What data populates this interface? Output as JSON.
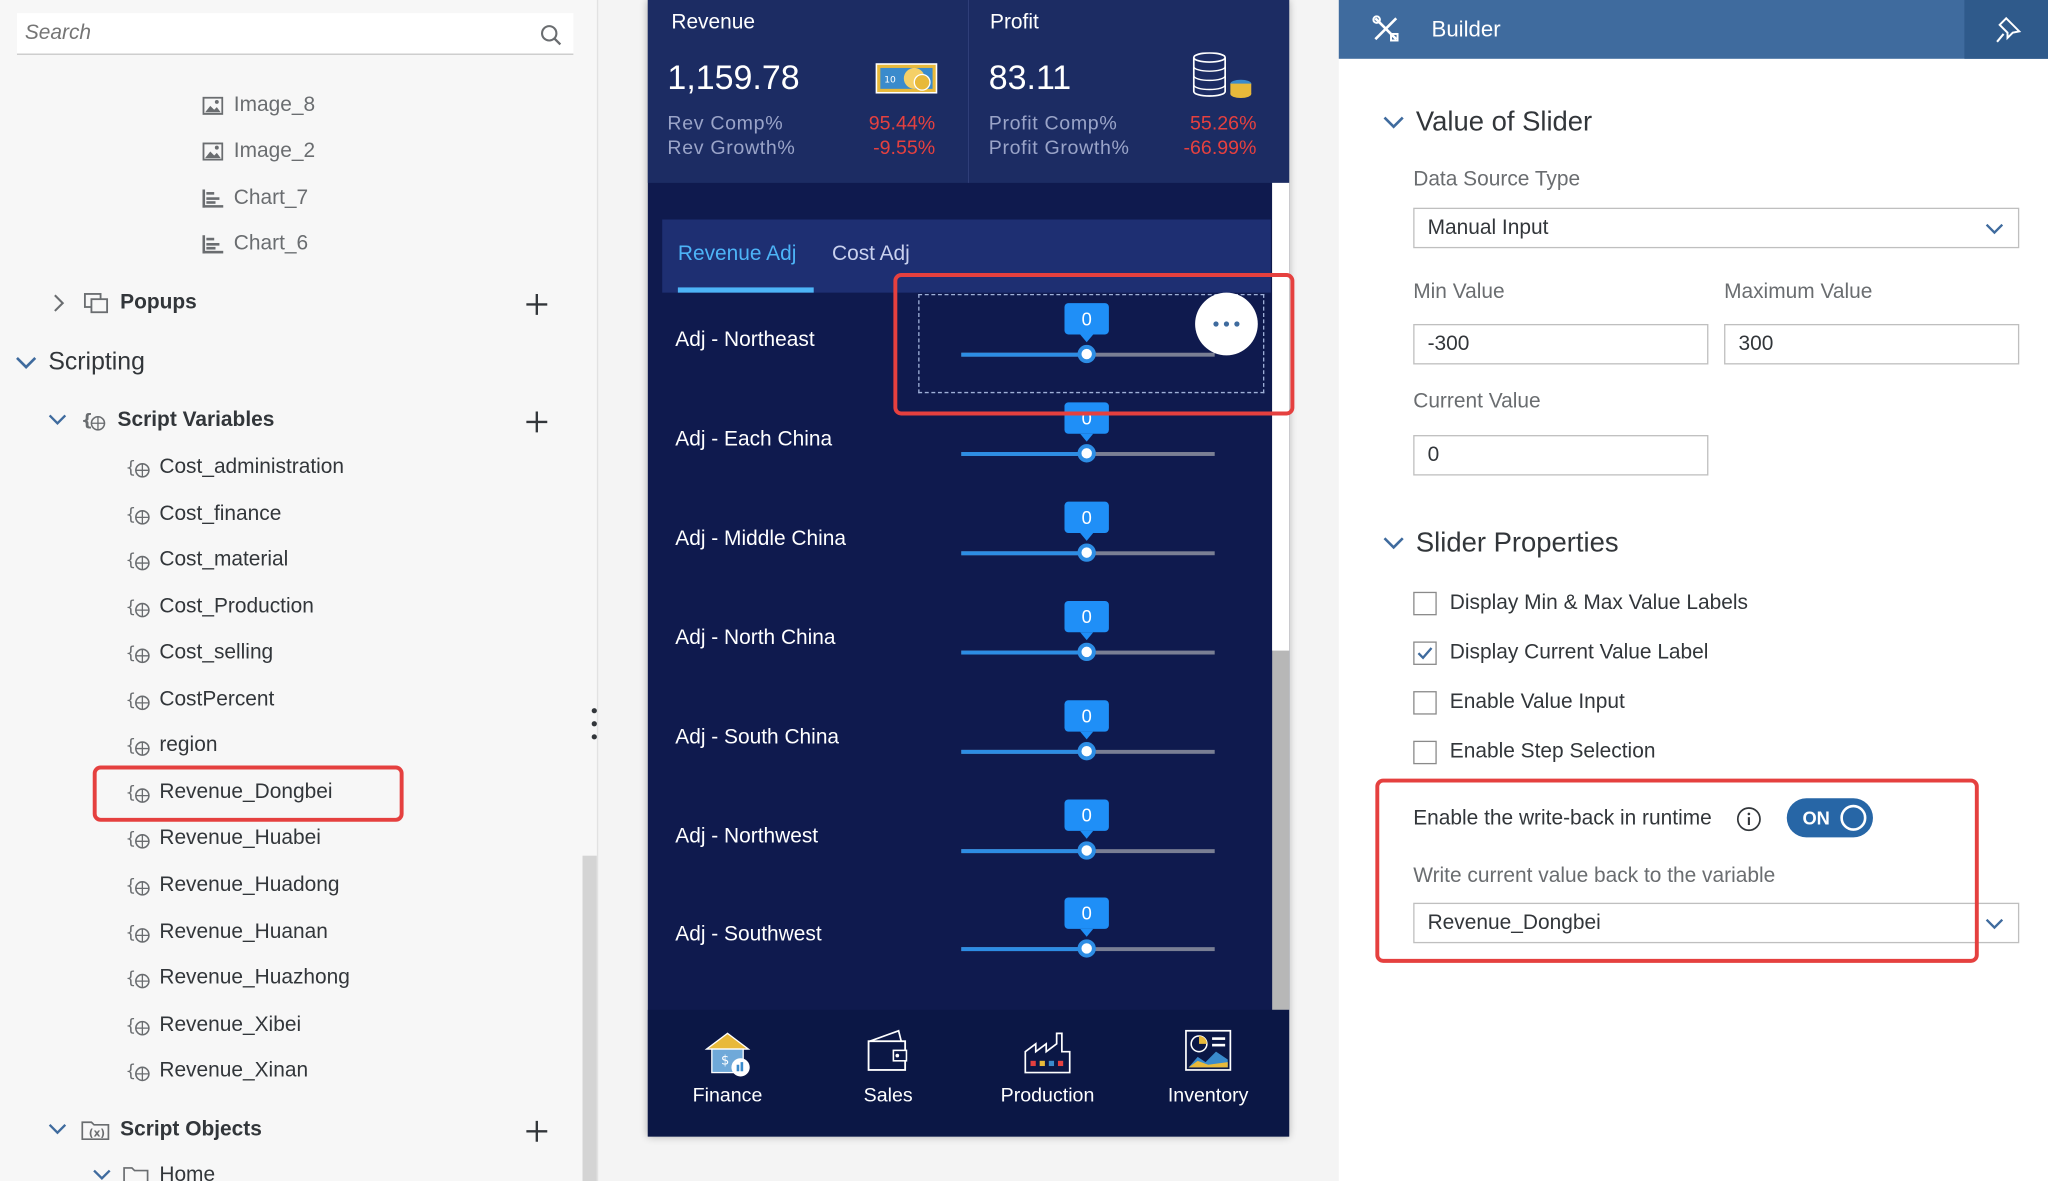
{
  "left": {
    "search_placeholder": "Search",
    "items": [
      {
        "label": "Image_8",
        "icon": "image-icon"
      },
      {
        "label": "Image_2",
        "icon": "image-icon"
      },
      {
        "label": "Chart_7",
        "icon": "chart-icon"
      },
      {
        "label": "Chart_6",
        "icon": "chart-icon"
      }
    ],
    "popups": "Popups",
    "scripting": "Scripting",
    "script_variables": "Script Variables",
    "variables": [
      "Cost_administration",
      "Cost_finance",
      "Cost_material",
      "Cost_Production",
      "Cost_selling",
      "CostPercent",
      "region",
      "Revenue_Dongbei",
      "Revenue_Huabei",
      "Revenue_Huadong",
      "Revenue_Huanan",
      "Revenue_Huazhong",
      "Revenue_Xibei",
      "Revenue_Xinan"
    ],
    "script_objects": "Script Objects",
    "home": "Home",
    "selected_variable": "Revenue_Dongbei"
  },
  "preview": {
    "revenue": {
      "title": "Revenue",
      "value": "1,159.78",
      "m1": "Rev Comp%",
      "v1": "95.44%",
      "m2": "Rev Growth%",
      "v2": "-9.55%"
    },
    "profit": {
      "title": "Profit",
      "value": "83.11",
      "m1": "Profit Comp%",
      "v1": "55.26%",
      "m2": "Profit Growth%",
      "v2": "-66.99%"
    },
    "tabs": [
      "Revenue Adj",
      "Cost Adj"
    ],
    "sliders": [
      {
        "label": "Adj - Northeast",
        "value": "0"
      },
      {
        "label": "Adj - Each China",
        "value": "0"
      },
      {
        "label": "Adj - Middle China",
        "value": "0"
      },
      {
        "label": "Adj - North China",
        "value": "0"
      },
      {
        "label": "Adj - South China",
        "value": "0"
      },
      {
        "label": "Adj - Northwest",
        "value": "0"
      },
      {
        "label": "Adj - Southwest",
        "value": "0"
      }
    ],
    "nav": [
      "Finance",
      "Sales",
      "Production",
      "Inventory"
    ]
  },
  "right": {
    "title": "Builder",
    "section1": "Value of Slider",
    "data_source_label": "Data Source Type",
    "data_source_value": "Manual Input",
    "min_label": "Min Value",
    "min_value": "-300",
    "max_label": "Maximum Value",
    "max_value": "300",
    "current_label": "Current Value",
    "current_value": "0",
    "section2": "Slider Properties",
    "checkboxes": [
      {
        "label": "Display Min & Max Value Labels",
        "checked": false
      },
      {
        "label": "Display Current Value Label",
        "checked": true
      },
      {
        "label": "Enable Value Input",
        "checked": false
      },
      {
        "label": "Enable Step Selection",
        "checked": false
      }
    ],
    "writeback_label": "Enable the write-back in runtime",
    "toggle_label": "ON",
    "writeback_var_label": "Write current value back to the variable",
    "writeback_var_value": "Revenue_Dongbei"
  },
  "colors": {
    "preview_bg": "#0f1a4e",
    "builder_bar": "#3f6b9e",
    "highlight": "#e5403f",
    "accent": "#2d8de4",
    "negative": "#e5403f"
  }
}
